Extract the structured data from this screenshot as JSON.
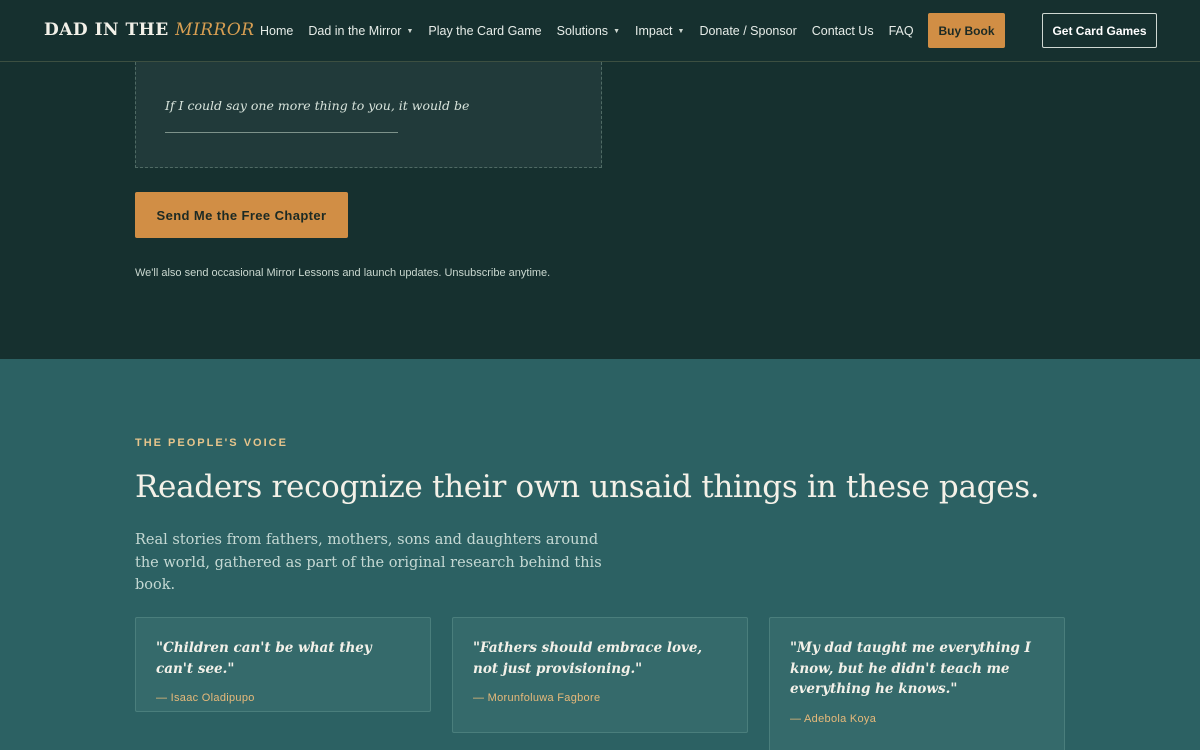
{
  "header": {
    "logo_main": "DAD IN THE",
    "logo_accent": "MIRROR",
    "nav": [
      {
        "label": "Home",
        "has_caret": false
      },
      {
        "label": "Dad in the Mirror",
        "has_caret": true
      },
      {
        "label": "Play the Card Game",
        "has_caret": false
      },
      {
        "label": "Solutions",
        "has_caret": true
      },
      {
        "label": "Impact",
        "has_caret": true
      },
      {
        "label": "Donate / Sponsor",
        "has_caret": false
      },
      {
        "label": "Contact Us",
        "has_caret": false
      },
      {
        "label": "FAQ",
        "has_caret": false
      }
    ],
    "buy_label": "Buy Book",
    "cards_label": "Get Card Games"
  },
  "form": {
    "prompt": "If I could say one more thing to you, it would be",
    "submit_label": "Send Me the Free Chapter",
    "fine_print": "We'll also send occasional Mirror Lessons and launch updates. Unsubscribe anytime."
  },
  "voice": {
    "eyebrow": "THE PEOPLE'S VOICE",
    "headline": "Readers recognize their own unsaid things in these pages.",
    "sub": "Real stories from fathers, mothers, sons and daughters around the world, gathered as part of the original research behind this book.",
    "testimonials": [
      {
        "quote": "\"Children can't be what they can't see.\"",
        "author": "— Isaac Oladipupo"
      },
      {
        "quote": "\"Fathers should embrace love, not just provisioning.\"",
        "author": "— Morunfoluwa Fagbore"
      },
      {
        "quote": "\"My dad taught me everything I know, but he didn't teach me everything he knows.\"",
        "author": "— Adebola Koya"
      }
    ]
  },
  "colors": {
    "dark_bg": "#16302f",
    "teal_bg": "#2c6163",
    "accent": "#d18e45",
    "eyebrow": "#e7c58c"
  },
  "icons": {
    "nav_caret": "caret-down-icon"
  }
}
